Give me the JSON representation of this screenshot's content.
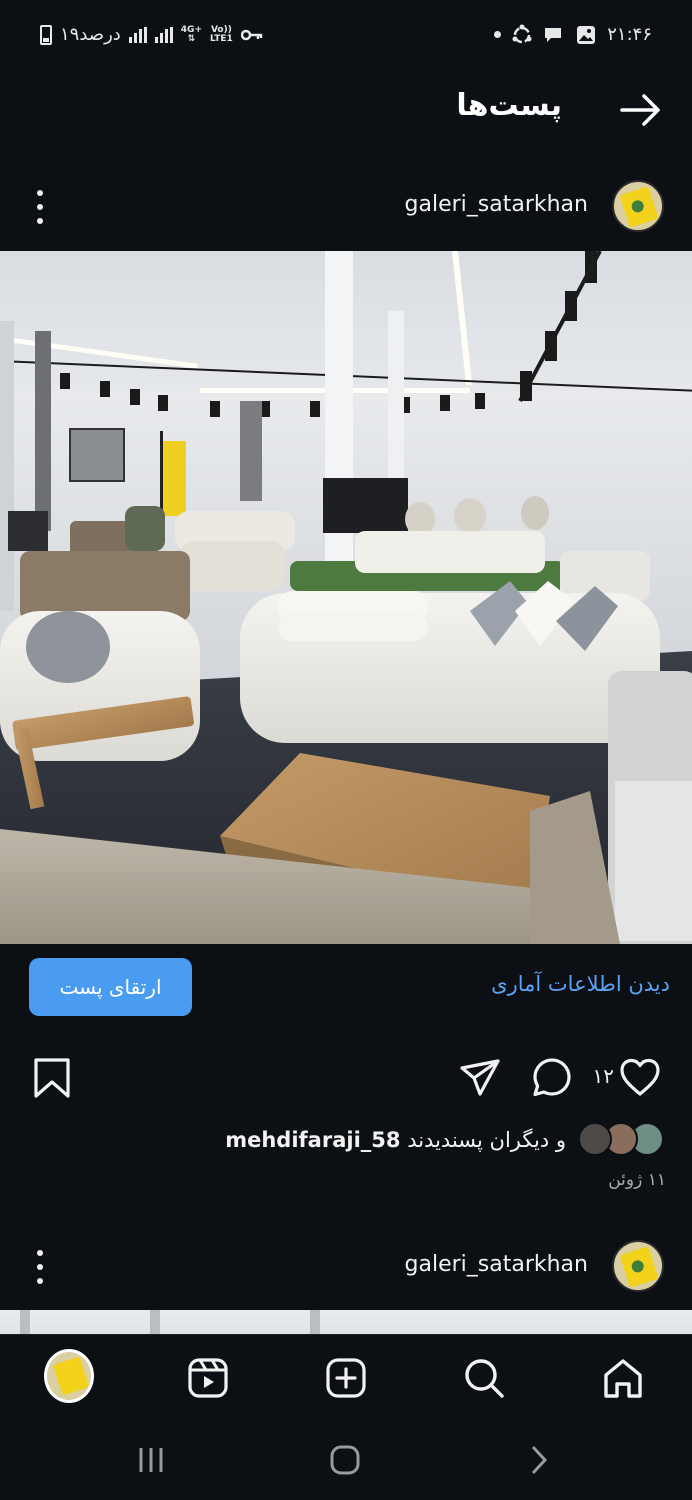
{
  "status_bar": {
    "time": "۲۱:۴۶",
    "battery_text": "۱۹درصد",
    "network_4g": "4G+",
    "network_volte_top": "Vo))",
    "network_volte_bottom": "LTE1"
  },
  "header": {
    "title": "پست‌ها"
  },
  "post1": {
    "username": "galeri_satarkhan",
    "promote_label": "ارتقای پست",
    "insights_label": "دیدن اطلاعات آماری",
    "like_count": "۱۲",
    "likes_prefix": "و دیگران پسندیدند",
    "likes_user": "mehdifaraji_58",
    "date": "۱۱ ژوئن"
  },
  "post2": {
    "username": "galeri_satarkhan"
  },
  "colors": {
    "background": "#0c1014",
    "accent": "#4a9cf0",
    "link": "#5aa3f7"
  },
  "icons": {
    "back": "arrow-right-icon",
    "more": "more-vertical-icon",
    "like": "heart-icon",
    "comment": "comment-icon",
    "share": "send-icon",
    "save": "bookmark-icon",
    "home": "home-icon",
    "search": "search-icon",
    "create": "plus-square-icon",
    "reels": "reels-icon",
    "profile": "profile-avatar"
  }
}
